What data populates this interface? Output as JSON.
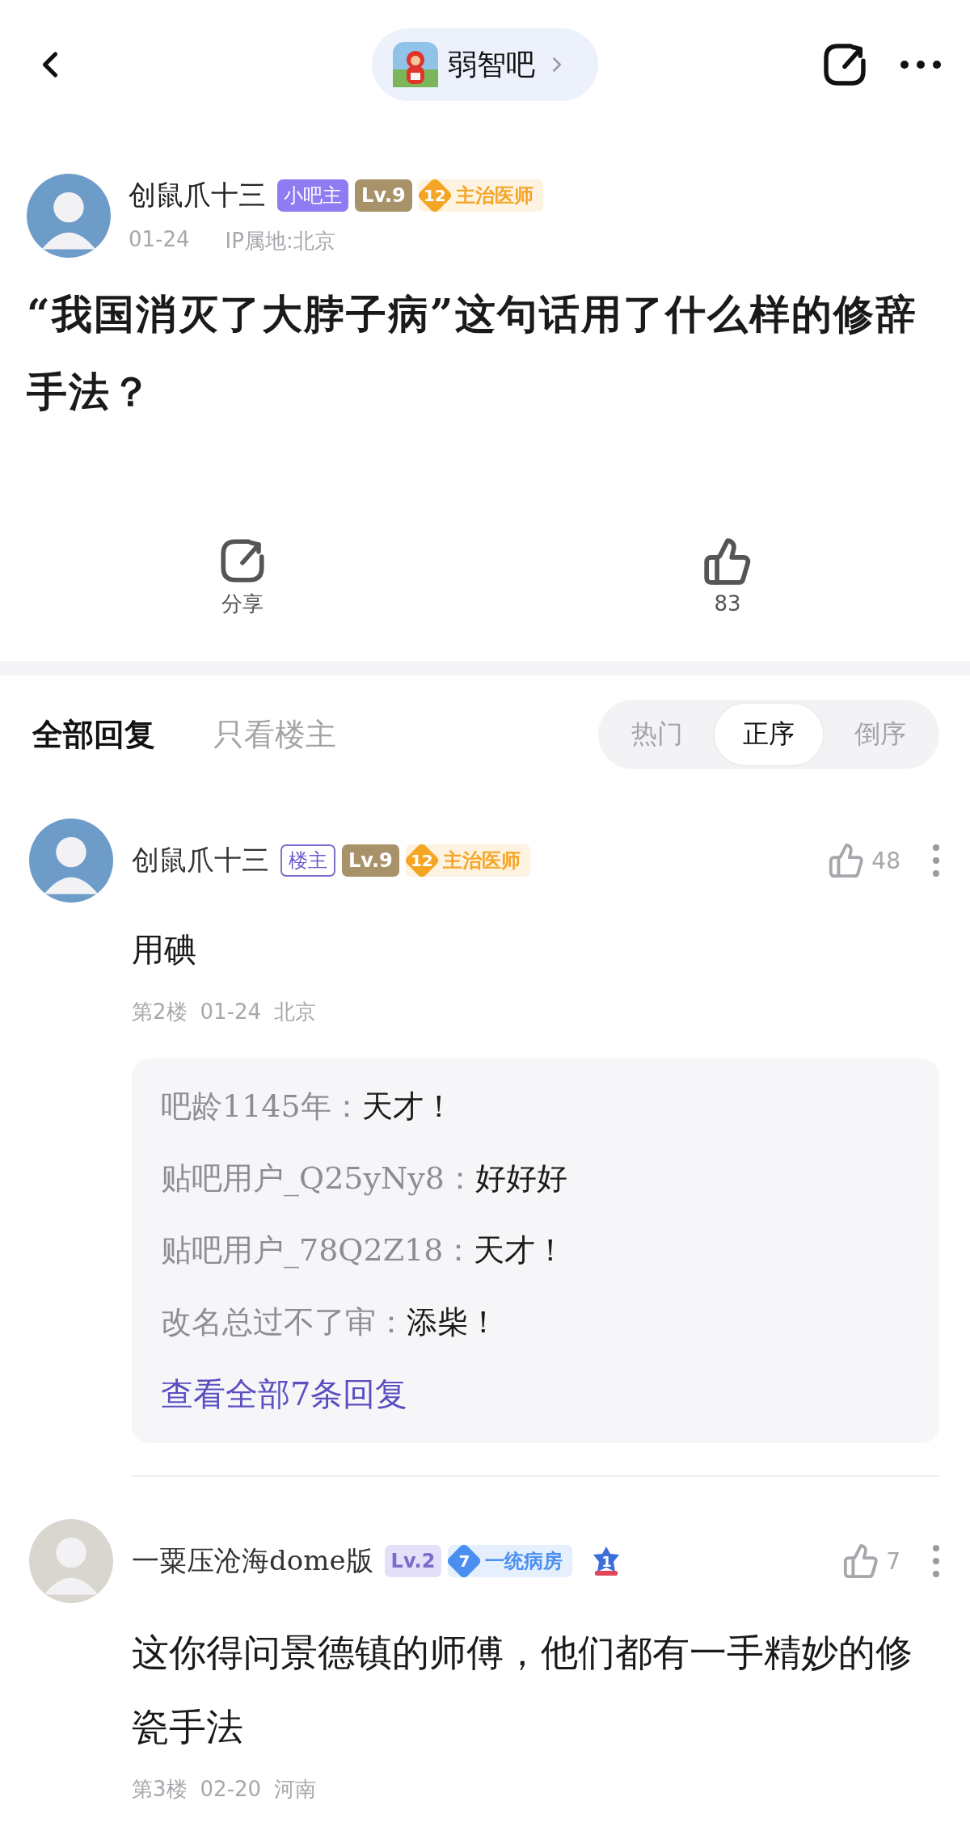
{
  "header": {
    "forum": "弱智吧"
  },
  "post": {
    "author": {
      "name": "创鼠爪十三",
      "badges": [
        {
          "kind": "moderator",
          "text": "小吧主"
        },
        {
          "kind": "level",
          "text": "Lv.9",
          "color": "#a8926a"
        },
        {
          "kind": "rank",
          "number": "12",
          "text": "主治医师",
          "color": "#f5a524"
        }
      ]
    },
    "date": "01-24",
    "location": "IP属地:北京",
    "title": "“我国消灭了大脖子病”这句话用了什么样的修辞手法？"
  },
  "actions": [
    {
      "kind": "share",
      "label": "分享"
    },
    {
      "kind": "like",
      "label": "83"
    }
  ],
  "reply_tabs": [
    {
      "label": "全部回复",
      "selected": true
    },
    {
      "label": "只看楼主",
      "selected": false
    }
  ],
  "sort_options": [
    {
      "label": "热门",
      "selected": false
    },
    {
      "label": "正序",
      "selected": true
    },
    {
      "label": "倒序",
      "selected": false
    }
  ],
  "replies": [
    {
      "author": {
        "name": "创鼠爪十三",
        "badges": [
          {
            "kind": "op",
            "text": "楼主"
          },
          {
            "kind": "level",
            "text": "Lv.9",
            "color": "#a8926a"
          },
          {
            "kind": "rank",
            "number": "12",
            "text": "主治医师",
            "color": "#f5a524"
          }
        ]
      },
      "likes": "48",
      "content": "用碘",
      "floor": "第2楼",
      "date": "01-24",
      "location": "北京",
      "sub_replies": [
        {
          "user": "吧龄1145年：",
          "text": "天才！"
        },
        {
          "user": "贴吧用户_Q25yNy8：",
          "text": "好好好"
        },
        {
          "user": "贴吧用户_78Q2Z18：",
          "text": "天才！"
        },
        {
          "user": "改名总过不了审：",
          "text": "添柴！"
        }
      ],
      "more_link": "查看全部7条回复"
    },
    {
      "author": {
        "name": "一粟压沧海dome版",
        "badges": [
          {
            "kind": "level",
            "text": "Lv.2",
            "color": "#e4e0fa"
          },
          {
            "kind": "rank",
            "number": "7",
            "text": "一统病房",
            "color": "#4a8ff0"
          },
          {
            "kind": "medal",
            "number": "1"
          }
        ]
      },
      "likes": "7",
      "content": "这你得问景德镇的师傅，他们都有一手精妙的修瓷手法",
      "floor": "第3楼",
      "date": "02-20",
      "location": "河南"
    }
  ]
}
